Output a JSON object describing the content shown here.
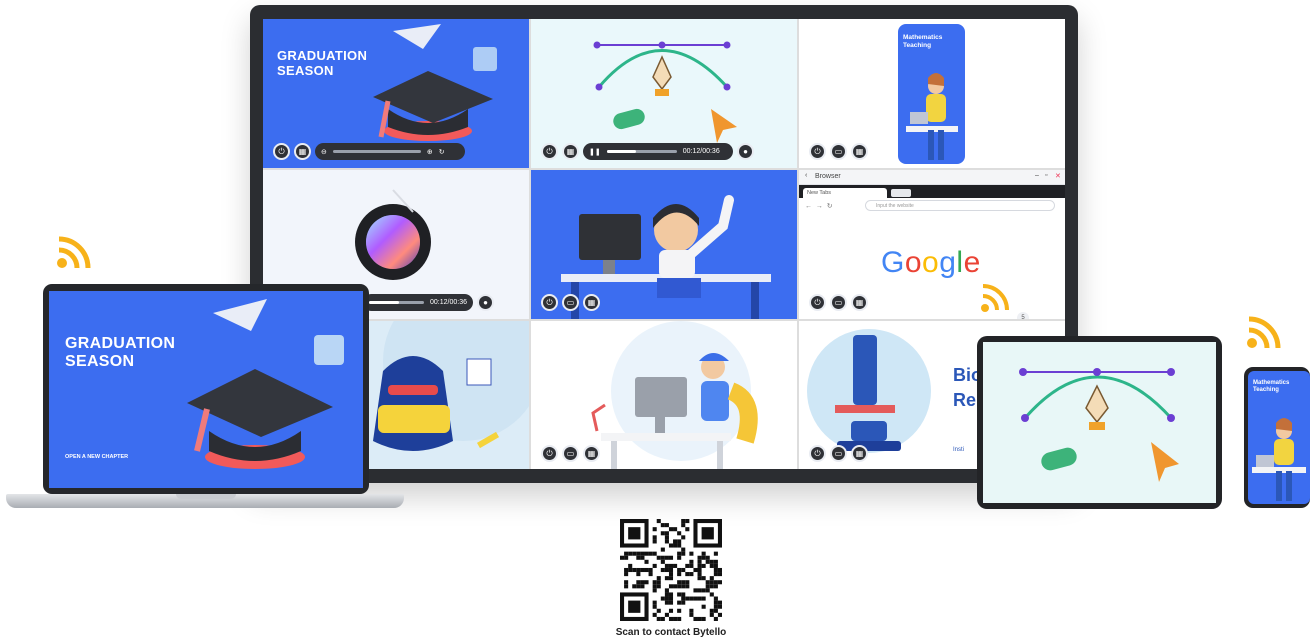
{
  "display": {
    "tiles": {
      "graduation": {
        "title_line1": "GRADUATION",
        "title_line2": "SEASON"
      },
      "pen_tool": {
        "timecode": "00:12/00:36"
      },
      "math_phone": {
        "title_line1": "Mathematics",
        "title_line2": "Teaching"
      },
      "record": {
        "timecode": "00:12/00:36"
      },
      "browser": {
        "window_title": "Browser",
        "tab_label": "New Tabs",
        "address_placeholder": "Input the website",
        "logo_letters": [
          "G",
          "o",
          "o",
          "g",
          "l",
          "e"
        ],
        "logo_colors": [
          "#4285F4",
          "#EA4335",
          "#FBBC05",
          "#4285F4",
          "#34A853",
          "#EA4335"
        ],
        "badge": "5"
      },
      "biology": {
        "title_partial1": "Bio",
        "title_partial2": "Re",
        "footer_partial": "Insti"
      }
    }
  },
  "laptop": {
    "title_line1": "GRADUATION",
    "title_line2": "SEASON",
    "subtitle": "OPEN A NEW CHAPTER"
  },
  "phone": {
    "title_line1": "Mathematics",
    "title_line2": "Teaching"
  },
  "caption": "Scan to contact Bytello",
  "colors": {
    "accent_blue": "#3C6DF0",
    "cast_orange": "#F7B21A",
    "bezier_green": "#2DB58A",
    "bezier_purple": "#6B3FD3"
  },
  "icons": [
    "power-icon",
    "grid-icon",
    "zoom-out-icon",
    "zoom-in-icon",
    "rotate-icon",
    "pause-icon",
    "camera-icon",
    "window-icon",
    "cast-icon",
    "close-icon"
  ]
}
